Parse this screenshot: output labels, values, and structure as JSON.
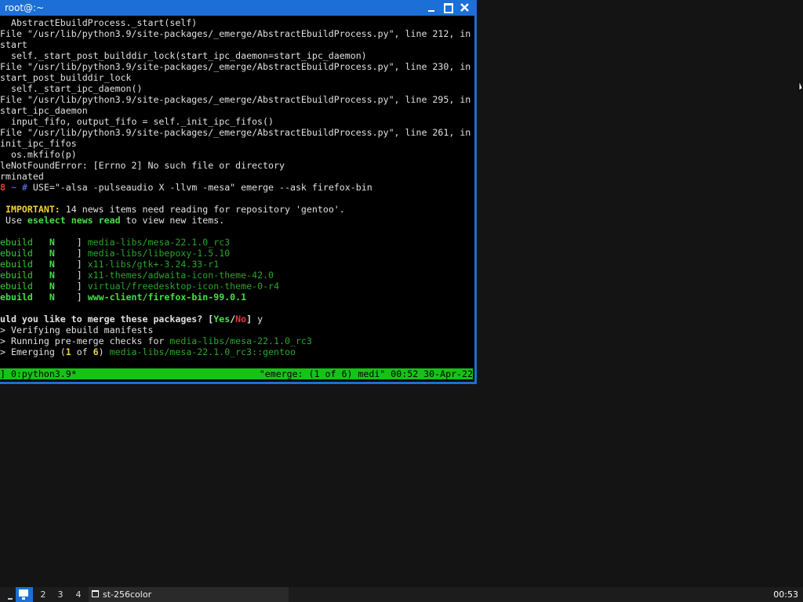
{
  "window": {
    "title": "root@:~"
  },
  "terminal": {
    "lines": [
      [
        {
          "t": "  AbstractEbuildProcess._start(self)"
        }
      ],
      [
        {
          "t": "File \"/usr/lib/python3.9/site-packages/_emerge/AbstractEbuildProcess.py\", line 212, in"
        }
      ],
      [
        {
          "t": "start"
        }
      ],
      [
        {
          "t": "  self._start_post_builddir_lock(start_ipc_daemon=start_ipc_daemon)"
        }
      ],
      [
        {
          "t": "File \"/usr/lib/python3.9/site-packages/_emerge/AbstractEbuildProcess.py\", line 230, in"
        }
      ],
      [
        {
          "t": "start_post_builddir_lock"
        }
      ],
      [
        {
          "t": "  self._start_ipc_daemon()"
        }
      ],
      [
        {
          "t": "File \"/usr/lib/python3.9/site-packages/_emerge/AbstractEbuildProcess.py\", line 295, in"
        }
      ],
      [
        {
          "t": "start_ipc_daemon"
        }
      ],
      [
        {
          "t": "  input_fifo, output_fifo = self._init_ipc_fifos()"
        }
      ],
      [
        {
          "t": "File \"/usr/lib/python3.9/site-packages/_emerge/AbstractEbuildProcess.py\", line 261, in"
        }
      ],
      [
        {
          "t": "init_ipc_fifos"
        }
      ],
      [
        {
          "t": "  os.mkfifo(p)"
        }
      ],
      [
        {
          "t": "leNotFoundError: [Errno 2] No such file or directory"
        }
      ],
      [
        {
          "t": "rminated"
        }
      ],
      [
        {
          "t": "8",
          "c": "red"
        },
        {
          "t": " ~ ",
          "c": "blue"
        },
        {
          "t": "# ",
          "c": "blue"
        },
        {
          "t": "USE=\"-alsa -pulseaudio X -llvm -mesa\" emerge --ask firefox-bin"
        }
      ],
      [
        {
          "t": ""
        }
      ],
      [
        {
          "t": " "
        },
        {
          "t": "IMPORTANT:",
          "c": "yel"
        },
        {
          "t": " 14 news items need reading for repository 'gentoo'."
        }
      ],
      [
        {
          "t": " Use "
        },
        {
          "t": "eselect news read",
          "c": "grnb"
        },
        {
          "t": " to view new items."
        }
      ],
      [
        {
          "t": ""
        }
      ],
      [
        {
          "t": "ebuild  ",
          "c": "grn"
        },
        {
          "t": " N ",
          "c": "grnb"
        },
        {
          "t": "   ] "
        },
        {
          "t": "media-libs/mesa-22.1.0_rc3",
          "c": "dgrn"
        }
      ],
      [
        {
          "t": "ebuild  ",
          "c": "grn"
        },
        {
          "t": " N ",
          "c": "grnb"
        },
        {
          "t": "   ] "
        },
        {
          "t": "media-libs/libepoxy-1.5.10",
          "c": "dgrn"
        }
      ],
      [
        {
          "t": "ebuild  ",
          "c": "grn"
        },
        {
          "t": " N ",
          "c": "grnb"
        },
        {
          "t": "   ] "
        },
        {
          "t": "x11-libs/gtk+-3.24.33-r1",
          "c": "dgrn"
        }
      ],
      [
        {
          "t": "ebuild  ",
          "c": "grn"
        },
        {
          "t": " N ",
          "c": "grnb"
        },
        {
          "t": "   ] "
        },
        {
          "t": "x11-themes/adwaita-icon-theme-42.0",
          "c": "dgrn"
        }
      ],
      [
        {
          "t": "ebuild  ",
          "c": "grn"
        },
        {
          "t": " N ",
          "c": "grnb"
        },
        {
          "t": "   ] "
        },
        {
          "t": "virtual/freedesktop-icon-theme-0-r4",
          "c": "dgrn"
        }
      ],
      [
        {
          "t": "ebuild  ",
          "c": "grnb"
        },
        {
          "t": " N ",
          "c": "grnb"
        },
        {
          "t": "   ] "
        },
        {
          "t": "www-client/firefox-bin-99.0.1",
          "c": "grnb"
        }
      ],
      [
        {
          "t": ""
        }
      ],
      [
        {
          "t": "uld you like to merge these packages? ",
          "c": "bold"
        },
        {
          "t": "[",
          "c": "bold"
        },
        {
          "t": "Yes",
          "c": "grnb"
        },
        {
          "t": "/",
          "c": "bold"
        },
        {
          "t": "No",
          "c": "red"
        },
        {
          "t": "]",
          "c": "bold"
        },
        {
          "t": " y"
        }
      ],
      [
        {
          "t": "> Verifying ebuild manifests"
        }
      ],
      [
        {
          "t": "> Running pre-merge checks for "
        },
        {
          "t": "media-libs/mesa-22.1.0_rc3",
          "c": "dgrn"
        }
      ],
      [
        {
          "t": "> Emerging ("
        },
        {
          "t": "1",
          "c": "yel"
        },
        {
          "t": " of "
        },
        {
          "t": "6",
          "c": "yel"
        },
        {
          "t": ") "
        },
        {
          "t": "media-libs/mesa-22.1.0_rc3::gentoo",
          "c": "dgrn"
        }
      ]
    ]
  },
  "statusbar": {
    "left": "] 0:python3.9*",
    "right": "\"emerge: (1 of 6) medi\" 00:52 30-Apr-22"
  },
  "taskbar": {
    "workspaces": [
      "2",
      "3",
      "4"
    ],
    "task_label": "st-256color",
    "clock": "00:53"
  },
  "colors": {
    "accent": "#1c6fd6",
    "status_green": "#17c217",
    "desktop": "#141414"
  }
}
